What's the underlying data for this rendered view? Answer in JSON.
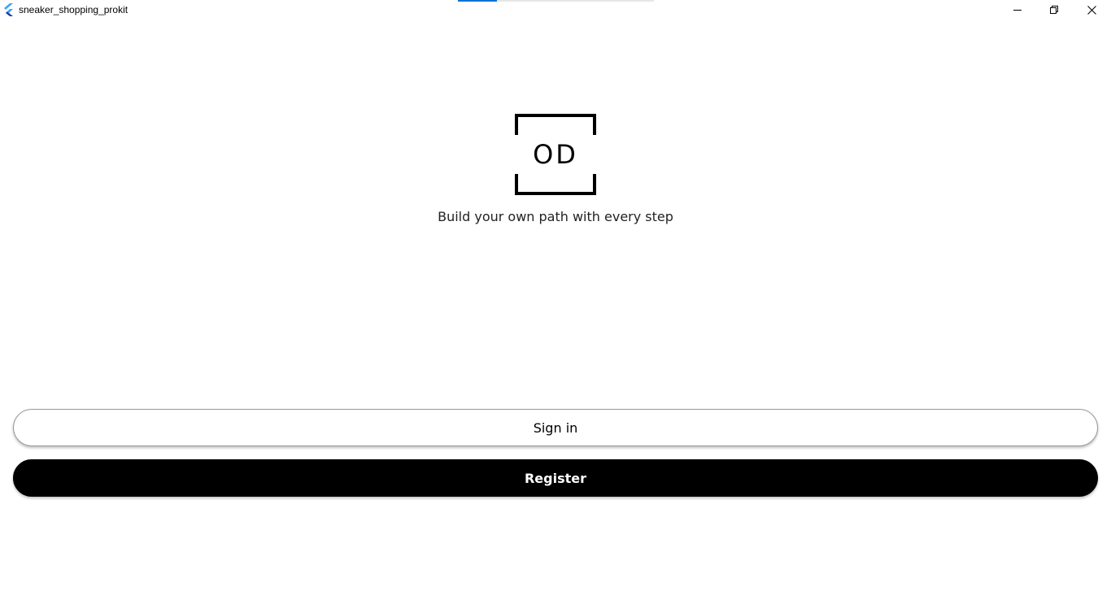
{
  "window": {
    "title": "sneaker_shopping_prokit",
    "loading_progress_percent": 20,
    "controls": [
      "minimize-icon",
      "maximize-icon",
      "close-icon"
    ]
  },
  "logo": {
    "text": "OD"
  },
  "tagline": "Build your own path with every step",
  "buttons": {
    "sign_in": "Sign in",
    "register": "Register"
  },
  "colors": {
    "accent": "#0a73d6",
    "primary_button": "#000000",
    "background": "#ffffff"
  }
}
